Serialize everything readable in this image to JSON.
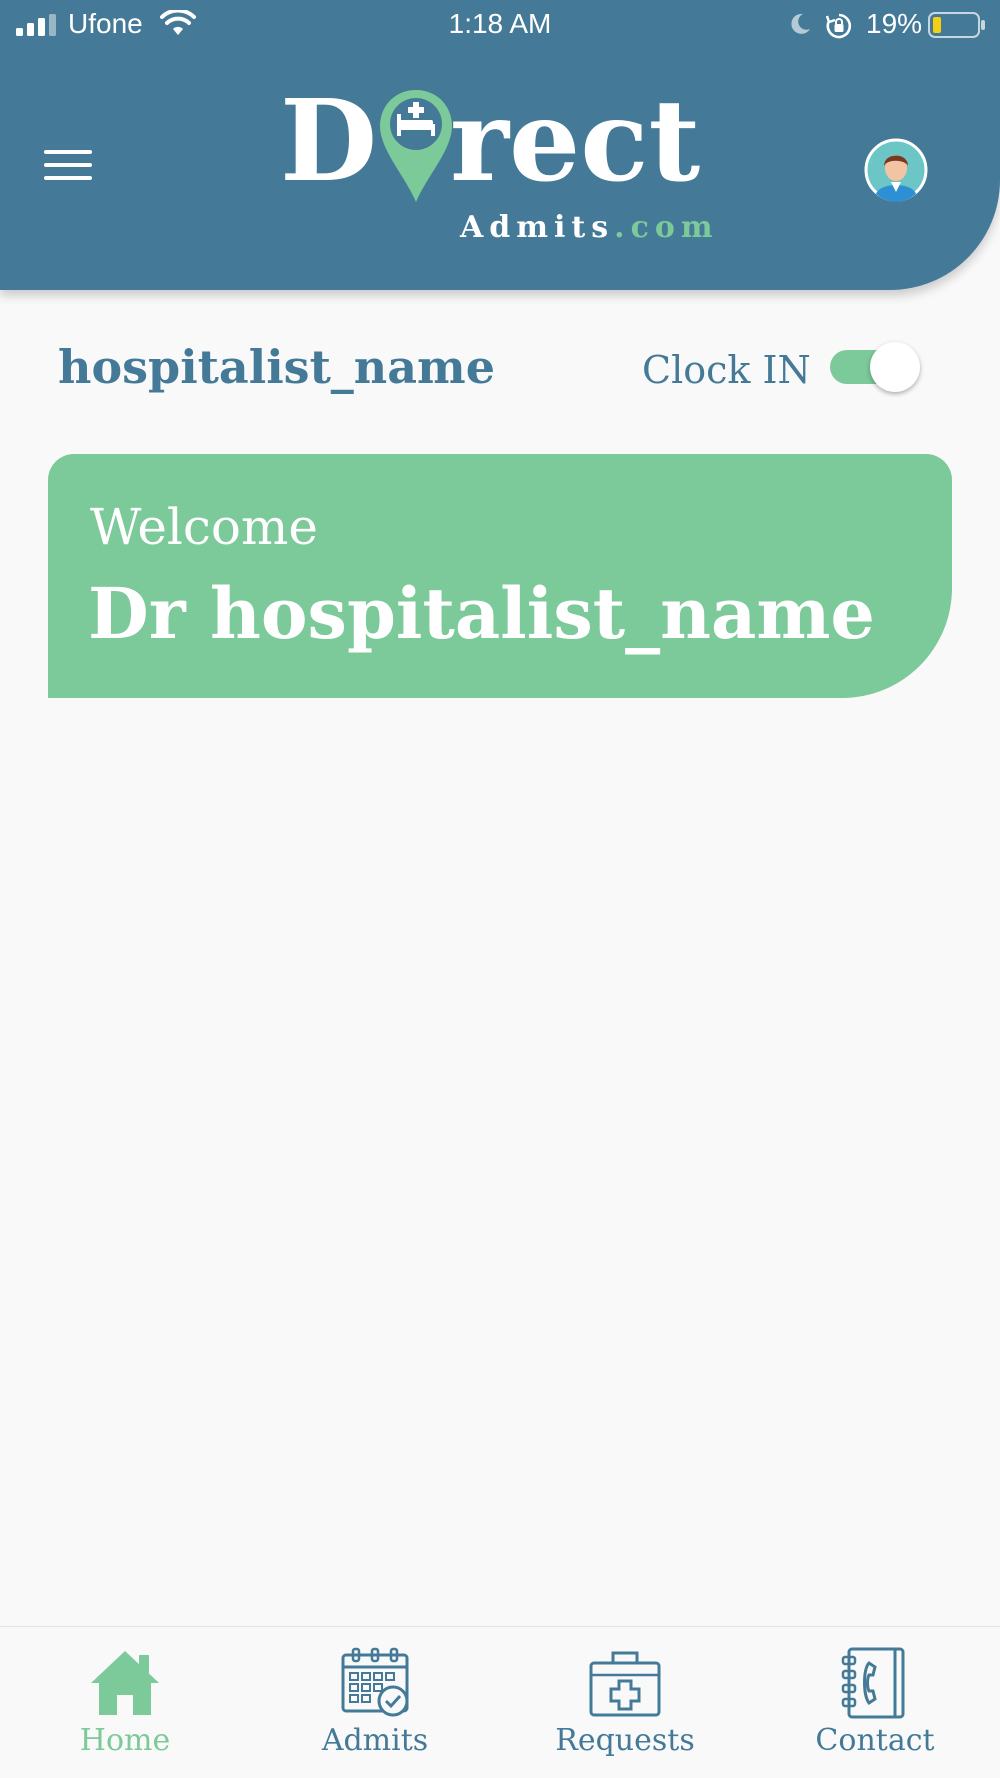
{
  "status_bar": {
    "carrier": "Ufone",
    "time": "1:18 AM",
    "battery_percent": "19%"
  },
  "header": {
    "logo_main": "Direct",
    "logo_sub_main": "Admits",
    "logo_sub_domain": ".com",
    "menu_icon": "hamburger-menu-icon",
    "avatar_icon": "doctor-avatar-icon"
  },
  "title_row": {
    "hospitalist_name": "hospitalist_name",
    "clock_label": "Clock IN",
    "clock_on": true
  },
  "welcome_card": {
    "greeting": "Welcome",
    "doctor_name": "Dr hospitalist_name"
  },
  "bottom_nav": {
    "items": [
      {
        "label": "Home",
        "icon": "home-icon",
        "active": true
      },
      {
        "label": "Admits",
        "icon": "calendar-check-icon",
        "active": false
      },
      {
        "label": "Requests",
        "icon": "medical-kit-icon",
        "active": false
      },
      {
        "label": "Contact",
        "icon": "phone-book-icon",
        "active": false
      }
    ]
  },
  "colors": {
    "primary": "#447a97",
    "accent": "#7cc99a",
    "background": "#f9f9f9"
  }
}
